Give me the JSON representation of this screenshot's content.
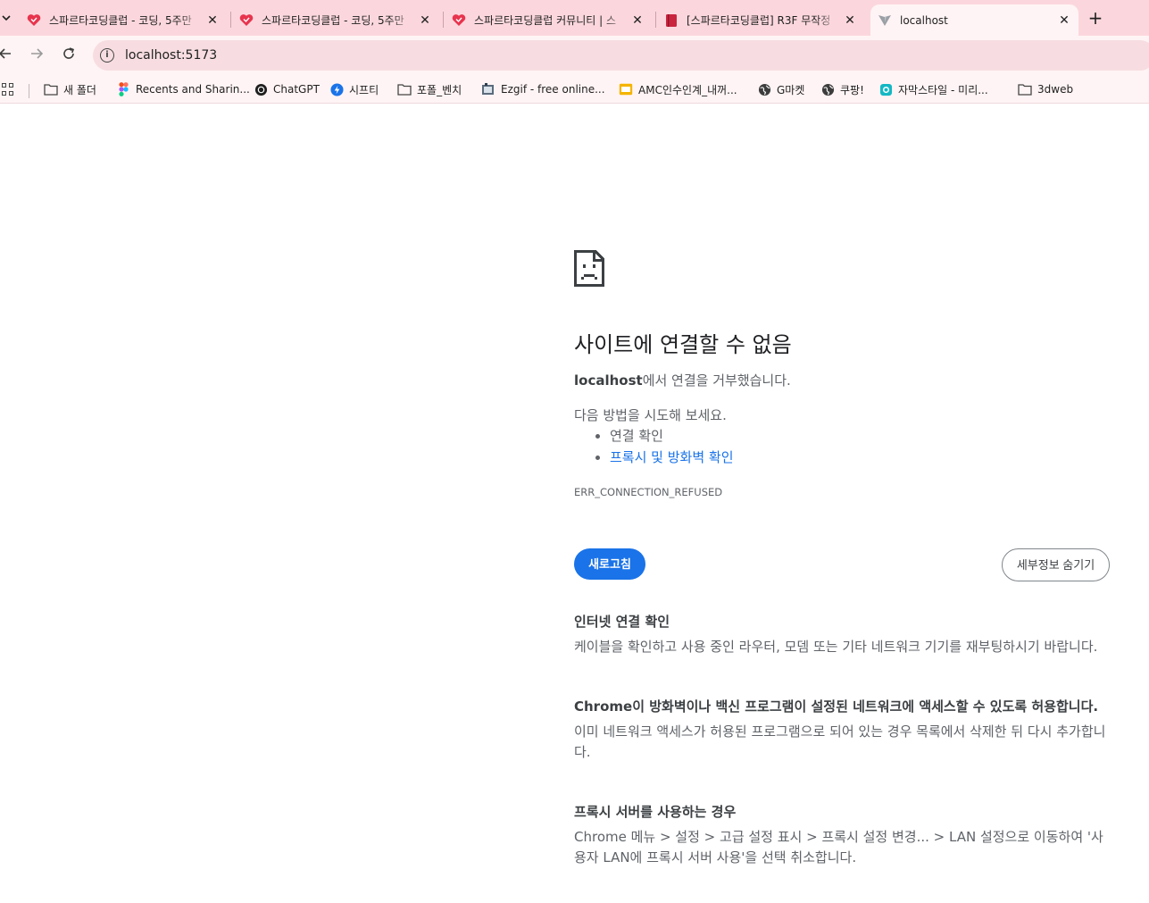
{
  "tabs": [
    {
      "title": "스파르타코딩클럽 - 코딩, 5주만",
      "active": false
    },
    {
      "title": "스파르타코딩클럽 - 코딩, 5주만",
      "active": false
    },
    {
      "title": "스파르타코딩클럽 커뮤니티 | 스",
      "active": false
    },
    {
      "title": "[스파르타코딩클럽] R3F 무작정",
      "active": false
    },
    {
      "title": "localhost",
      "active": true
    }
  ],
  "toolbar": {
    "url": "localhost:5173"
  },
  "bookmarks": [
    {
      "label": "새 폴더",
      "icon": "folder-icon"
    },
    {
      "label": "Recents and Sharin...",
      "icon": "figma-icon"
    },
    {
      "label": "ChatGPT",
      "icon": "chatgpt-icon"
    },
    {
      "label": "시프티",
      "icon": "shiftee-icon"
    },
    {
      "label": "포폴_벤치",
      "icon": "folder-icon"
    },
    {
      "label": "Ezgif - free online...",
      "icon": "ezgif-icon"
    },
    {
      "label": "AMC인수인계_내꺼...",
      "icon": "slides-icon"
    },
    {
      "label": "G마켓",
      "icon": "globe-icon"
    },
    {
      "label": "쿠팡!",
      "icon": "globe-icon"
    },
    {
      "label": "자막스타일 - 미리...",
      "icon": "vrew-icon"
    },
    {
      "label": "3dweb",
      "icon": "folder-icon"
    }
  ],
  "error": {
    "title": "사이트에 연결할 수 없음",
    "host": "localhost",
    "message_suffix": "에서 연결을 거부했습니다.",
    "suggest": "다음 방법을 시도해 보세요.",
    "suggestions": [
      "연결 확인",
      "프록시 및 방화벽 확인"
    ],
    "code": "ERR_CONNECTION_REFUSED",
    "reload_label": "새로고침",
    "details_label": "세부정보 숨기기"
  },
  "details": [
    {
      "heading": "인터넷 연결 확인",
      "body": "케이블을 확인하고 사용 중인 라우터, 모뎀 또는 기타 네트워크 기기를 재부팅하시기 바랍니다."
    },
    {
      "heading": "Chrome이 방화벽이나 백신 프로그램이 설정된 네트워크에 액세스할 수 있도록 허용합니다.",
      "body": "이미 네트워크 액세스가 허용된 프로그램으로 되어 있는 경우 목록에서 삭제한 뒤 다시 추가합니다."
    },
    {
      "heading": "프록시 서버를 사용하는 경우",
      "body": "Chrome 메뉴 > 설정 > 고급 설정 표시 > 프록시 설정 변경... > LAN 설정으로 이동하여 '사용자 LAN에 프록시 서버 사용'을 선택 취소합니다."
    }
  ],
  "colors": {
    "tabstrip": "#fbd7dd",
    "toolbar": "#fff4f5",
    "accent": "#1a73e8",
    "spartaRed": "#e8344e"
  }
}
